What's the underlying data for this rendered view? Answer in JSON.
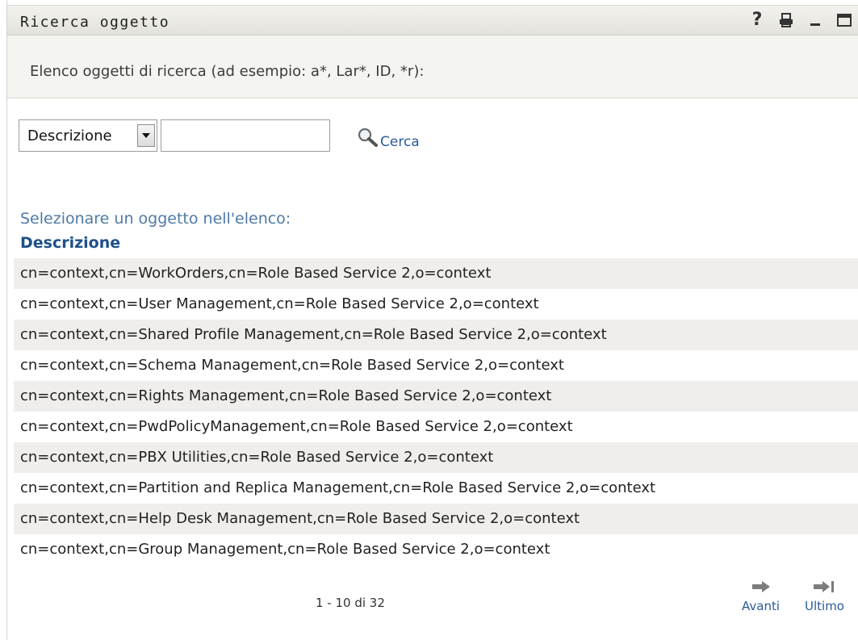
{
  "portlet": {
    "title": "Ricerca oggetto",
    "icons": [
      "help-icon",
      "print-icon",
      "minimize-icon",
      "maximize-icon"
    ]
  },
  "instructions": {
    "text": "Elenco oggetti di ricerca (ad esempio: a*, Lar*, ID, *r):"
  },
  "search": {
    "field_select_value": "Descrizione",
    "input_value": "",
    "button_label": "Cerca"
  },
  "results": {
    "prompt": "Selezionare un oggetto nell'elenco:",
    "column_header": "Descrizione",
    "rows": [
      "cn=context,cn=WorkOrders,cn=Role Based Service 2,o=context",
      "cn=context,cn=User Management,cn=Role Based Service 2,o=context",
      "cn=context,cn=Shared Profile Management,cn=Role Based Service 2,o=context",
      "cn=context,cn=Schema Management,cn=Role Based Service 2,o=context",
      "cn=context,cn=Rights Management,cn=Role Based Service 2,o=context",
      "cn=context,cn=PwdPolicyManagement,cn=Role Based Service 2,o=context",
      "cn=context,cn=PBX Utilities,cn=Role Based Service 2,o=context",
      "cn=context,cn=Partition and Replica Management,cn=Role Based Service 2,o=context",
      "cn=context,cn=Help Desk Management,cn=Role Based Service 2,o=context",
      "cn=context,cn=Group Management,cn=Role Based Service 2,o=context"
    ]
  },
  "pagination": {
    "summary": "1 - 10 di 32",
    "next_label": "Avanti",
    "last_label": "Ultimo"
  }
}
